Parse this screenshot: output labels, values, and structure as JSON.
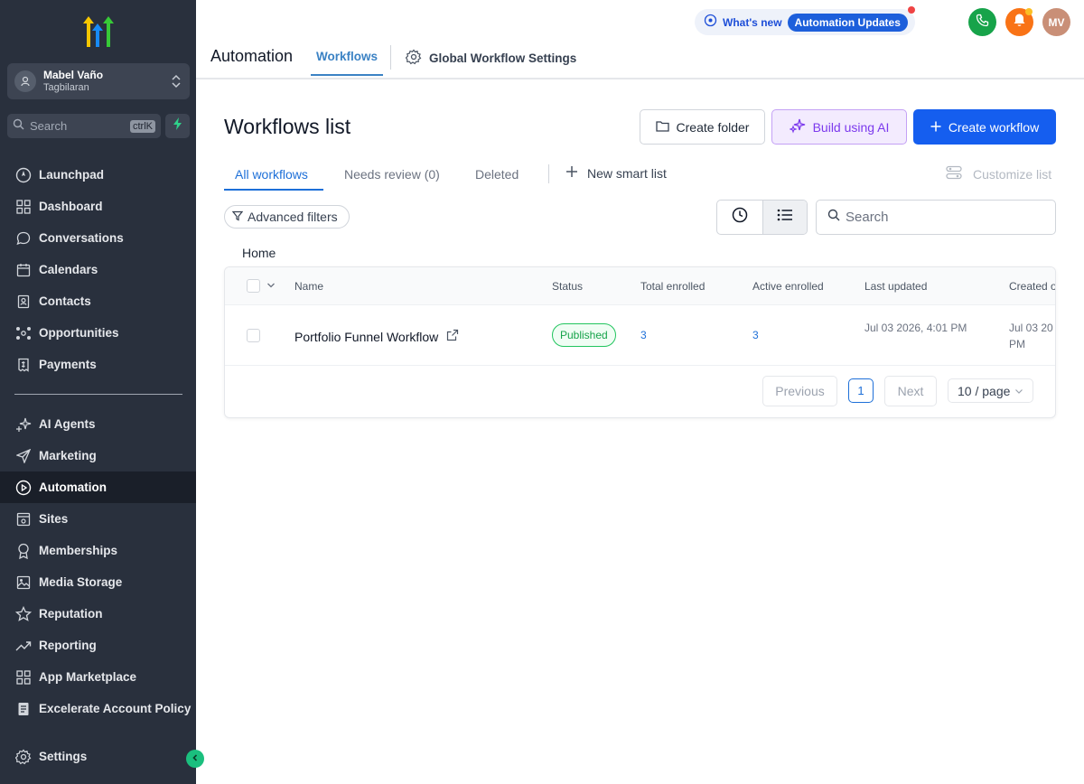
{
  "sidebar": {
    "account": {
      "name": "Mabel Vaño",
      "location": "Tagbilaran"
    },
    "search": {
      "placeholder": "Search",
      "shortcut": "ctrlK"
    },
    "items_top": [
      {
        "label": "Launchpad",
        "icon": "launchpad-icon"
      },
      {
        "label": "Dashboard",
        "icon": "dashboard-icon"
      },
      {
        "label": "Conversations",
        "icon": "chat-icon"
      },
      {
        "label": "Calendars",
        "icon": "calendar-icon"
      },
      {
        "label": "Contacts",
        "icon": "contacts-icon"
      },
      {
        "label": "Opportunities",
        "icon": "opportunities-icon"
      },
      {
        "label": "Payments",
        "icon": "payments-icon"
      }
    ],
    "items_bottom": [
      {
        "label": "AI Agents",
        "icon": "sparkle-icon"
      },
      {
        "label": "Marketing",
        "icon": "send-icon"
      },
      {
        "label": "Automation",
        "icon": "automation-icon",
        "active": true
      },
      {
        "label": "Sites",
        "icon": "sites-icon"
      },
      {
        "label": "Memberships",
        "icon": "award-icon"
      },
      {
        "label": "Media Storage",
        "icon": "image-icon"
      },
      {
        "label": "Reputation",
        "icon": "star-icon"
      },
      {
        "label": "Reporting",
        "icon": "trend-icon"
      },
      {
        "label": "App Marketplace",
        "icon": "grid-icon"
      },
      {
        "label": "Excelerate Account Policy",
        "icon": "document-icon"
      }
    ],
    "settings_label": "Settings"
  },
  "header": {
    "whats_new": "What's new",
    "automation_updates": "Automation Updates",
    "avatar_initials": "MV",
    "section_title": "Automation",
    "tab_workflows": "Workflows",
    "global_settings": "Global Workflow Settings"
  },
  "main": {
    "title": "Workflows list",
    "buttons": {
      "create_folder": "Create folder",
      "build_ai": "Build using AI",
      "create_workflow": "Create workflow"
    },
    "tabs": {
      "all": "All workflows",
      "needs_review": "Needs review (0)",
      "deleted": "Deleted",
      "new_smart_list": "New smart list",
      "customize_list": "Customize list"
    },
    "advanced_filters": "Advanced filters",
    "search_placeholder": "Search",
    "breadcrumb": "Home",
    "table": {
      "columns": [
        "Name",
        "Status",
        "Total enrolled",
        "Active enrolled",
        "Last updated",
        "Created o"
      ],
      "rows": [
        {
          "name": "Portfolio Funnel Workflow",
          "status": "Published",
          "total_enrolled": "3",
          "active_enrolled": "3",
          "last_updated": "Jul 03 2026, 4:01 PM",
          "created": "Jul 03 20 PM"
        }
      ]
    },
    "pagination": {
      "previous": "Previous",
      "page": "1",
      "next": "Next",
      "page_size": "10 / page"
    }
  },
  "colors": {
    "sidebar_bg": "#29303d",
    "primary": "#155eef",
    "accent_link": "#3b82c4",
    "ai_purple": "#7c3aed",
    "published_green": "#16a34a"
  }
}
